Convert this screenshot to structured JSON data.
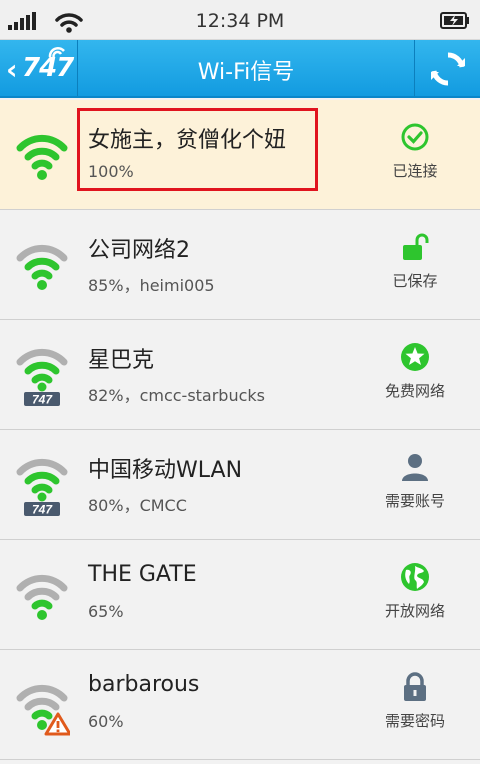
{
  "status_bar": {
    "time": "12:34 PM"
  },
  "nav": {
    "back_logo": "747",
    "title": "Wi-Fi信号"
  },
  "colors": {
    "accent": "#1aa6e6",
    "signal_green": "#2ec52e",
    "signal_gray": "#b0b0b0",
    "connected_bg": "#fdf2d9"
  },
  "networks": [
    {
      "ssid": "女施主，贫僧化个妞",
      "detail": "100%",
      "status": "已连接",
      "status_icon": "check-circle-icon"
    },
    {
      "ssid": "公司网络2",
      "detail": "85%，heimi005",
      "status": "已保存",
      "status_icon": "unlock-icon"
    },
    {
      "ssid": "星巴克",
      "detail": "82%，cmcc-starbucks",
      "status": "免费网络",
      "status_icon": "star-circle-icon",
      "badge": "747"
    },
    {
      "ssid": "中国移动WLAN",
      "detail": "80%，CMCC",
      "status": "需要账号",
      "status_icon": "user-icon",
      "badge": "747"
    },
    {
      "ssid": "THE GATE",
      "detail": "65%",
      "status": "开放网络",
      "status_icon": "globe-icon"
    },
    {
      "ssid": "barbarous",
      "detail": "60%",
      "status": "需要密码",
      "status_icon": "lock-icon"
    }
  ]
}
